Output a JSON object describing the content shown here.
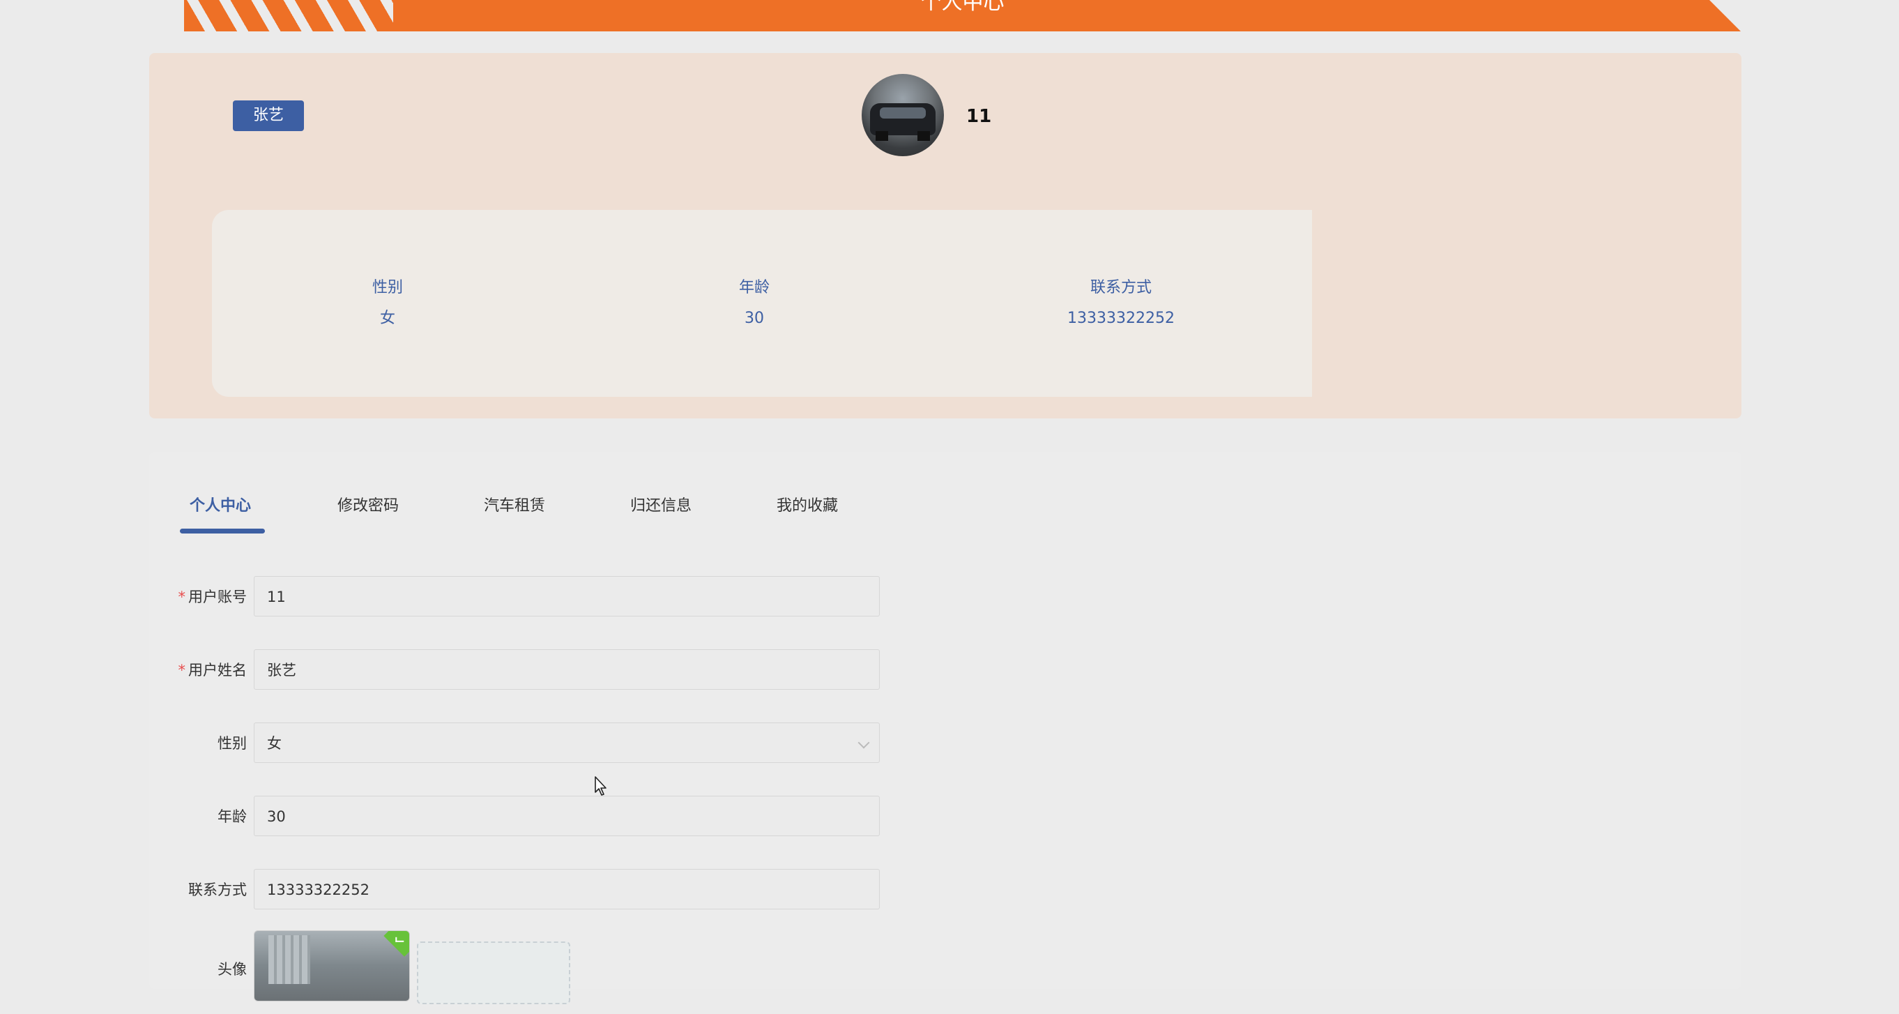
{
  "header": {
    "title": "个人中心"
  },
  "profile": {
    "name_tag": "张艺",
    "account": "11",
    "info": [
      {
        "label": "性别",
        "value": "女"
      },
      {
        "label": "年龄",
        "value": "30"
      },
      {
        "label": "联系方式",
        "value": "13333322252"
      }
    ]
  },
  "tabs": [
    {
      "label": "个人中心",
      "active": true
    },
    {
      "label": "修改密码",
      "active": false
    },
    {
      "label": "汽车租赁",
      "active": false
    },
    {
      "label": "归还信息",
      "active": false
    },
    {
      "label": "我的收藏",
      "active": false
    }
  ],
  "form": {
    "account": {
      "label": "用户账号",
      "value": "11",
      "required": true
    },
    "name": {
      "label": "用户姓名",
      "value": "张艺",
      "required": true
    },
    "gender": {
      "label": "性别",
      "value": "女"
    },
    "age": {
      "label": "年龄",
      "value": "30"
    },
    "phone": {
      "label": "联系方式",
      "value": "13333322252"
    },
    "avatar": {
      "label": "头像"
    }
  },
  "required_mark": "*",
  "colors": {
    "banner": "#ee7026",
    "accent": "#3d5fa3",
    "panel_bg": "#efdfd4",
    "required": "#e84e4e",
    "upload_success": "#67c23a"
  }
}
